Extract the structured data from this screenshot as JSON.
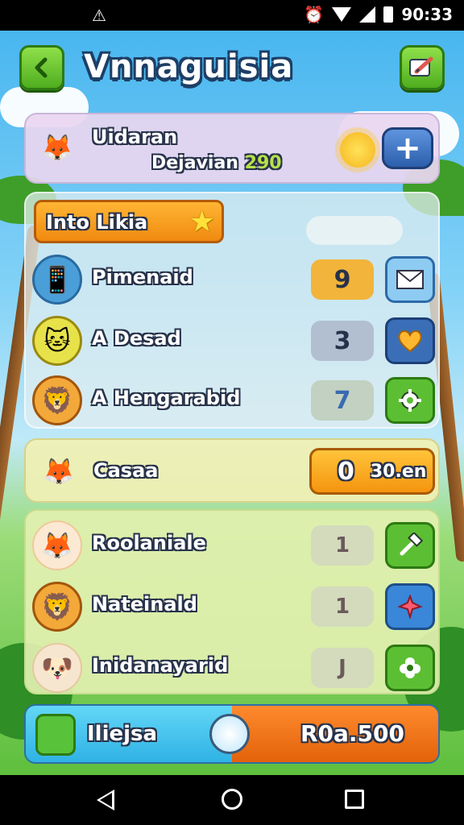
{
  "status_bar": {
    "time": "90:33",
    "alert_icon": "warning-triangle-icon"
  },
  "header": {
    "title": "Vnnaguisia",
    "back_icon": "chevron-left-icon",
    "edit_icon": "edit-card-icon"
  },
  "profile": {
    "name": "Uidaran",
    "subtitle": "Dejavian",
    "score": "290",
    "plus_symbol": "+"
  },
  "list1": {
    "header": "Into Likia",
    "rows": [
      {
        "label": "Pimenaid",
        "badge": "9",
        "action_icon": "envelope-icon",
        "avatar_icon": "phone-avatar"
      },
      {
        "label": "A Desad",
        "badge": "3",
        "action_icon": "heart-icon",
        "avatar_icon": "cat-avatar"
      },
      {
        "label": "A Hengarabid",
        "badge": "7",
        "action_icon": "gear-icon",
        "avatar_icon": "lion-avatar"
      }
    ]
  },
  "casa": {
    "label": "Casaa",
    "value_a": "0",
    "value_b": "30.en"
  },
  "list2": {
    "rows": [
      {
        "label": "Roolaniale",
        "badge": "1",
        "action_icon": "hammer-icon"
      },
      {
        "label": "Nateinald",
        "badge": "1",
        "action_icon": "star-ribbon-icon"
      },
      {
        "label": "Inidanayarid",
        "badge": "J",
        "action_icon": "clover-icon"
      }
    ]
  },
  "bottom_bar": {
    "label": "Iliejsa",
    "value": "R0a.500"
  },
  "colors": {
    "accent_green": "#4fae1f",
    "accent_orange": "#f5940f",
    "accent_blue": "#2c5fab"
  }
}
